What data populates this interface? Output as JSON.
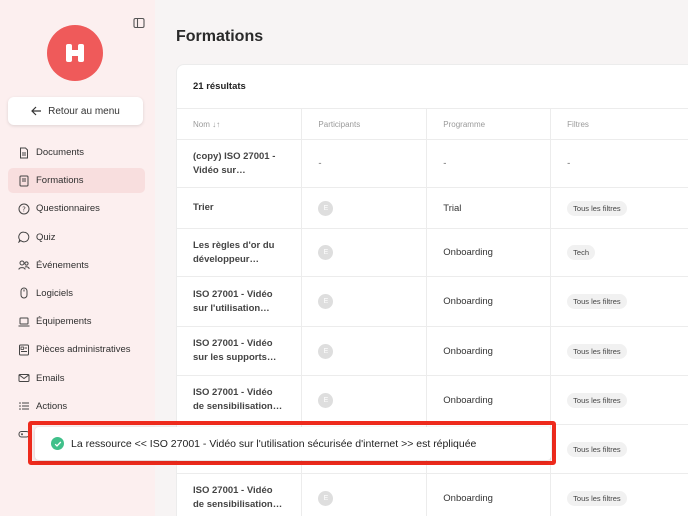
{
  "sidebar": {
    "back_label": "Retour au menu",
    "items": [
      {
        "label": "Documents",
        "icon": "document-icon"
      },
      {
        "label": "Formations",
        "icon": "book-icon",
        "active": true
      },
      {
        "label": "Questionnaires",
        "icon": "question-icon"
      },
      {
        "label": "Quiz",
        "icon": "chat-icon"
      },
      {
        "label": "Événements",
        "icon": "people-icon"
      },
      {
        "label": "Logiciels",
        "icon": "mouse-icon"
      },
      {
        "label": "Équipements",
        "icon": "laptop-icon"
      },
      {
        "label": "Pièces administratives",
        "icon": "id-card-icon"
      },
      {
        "label": "Emails",
        "icon": "mail-icon"
      },
      {
        "label": "Actions",
        "icon": "list-icon"
      },
      {
        "label": "",
        "icon": "gamepad-icon"
      }
    ]
  },
  "main": {
    "title": "Formations",
    "results": "21 résultats",
    "columns": [
      "Nom ↓↑",
      "Participants",
      "Programme",
      "Filtres"
    ],
    "rows": [
      {
        "name1": "(copy) ISO 27001 -",
        "name2": "Vidéo sur…",
        "participants": "-",
        "programme": "-",
        "filtre": "-"
      },
      {
        "name1": "Trier",
        "name2": "",
        "participants": "E",
        "programme": "Trial",
        "filtre": "Tous les filtres"
      },
      {
        "name1": "Les règles d'or du",
        "name2": "développeur…",
        "participants": "E",
        "programme": "Onboarding",
        "filtre": "Tech"
      },
      {
        "name1": "ISO 27001 - Vidéo",
        "name2": "sur l'utilisation…",
        "participants": "E",
        "programme": "Onboarding",
        "filtre": "Tous les filtres"
      },
      {
        "name1": "ISO 27001 - Vidéo",
        "name2": "sur les supports…",
        "participants": "E",
        "programme": "Onboarding",
        "filtre": "Tous les filtres"
      },
      {
        "name1": "ISO 27001 - Vidéo",
        "name2": "de sensibilisation…",
        "participants": "E",
        "programme": "Onboarding",
        "filtre": "Tous les filtres"
      },
      {
        "name1": "",
        "name2": "",
        "participants": "",
        "programme": "",
        "filtre": "Tous les filtres"
      },
      {
        "name1": "ISO 27001 - Vidéo",
        "name2": "de sensibilisation…",
        "participants": "E",
        "programme": "Onboarding",
        "filtre": "Tous les filtres"
      }
    ]
  },
  "toast": {
    "message": "La ressource << ISO 27001 - Vidéo sur l'utilisation sécurisée d'internet >> est répliquée"
  },
  "colors": {
    "brand": "#ef5a5a",
    "success": "#40c08a",
    "highlight": "#ee2a1c"
  }
}
